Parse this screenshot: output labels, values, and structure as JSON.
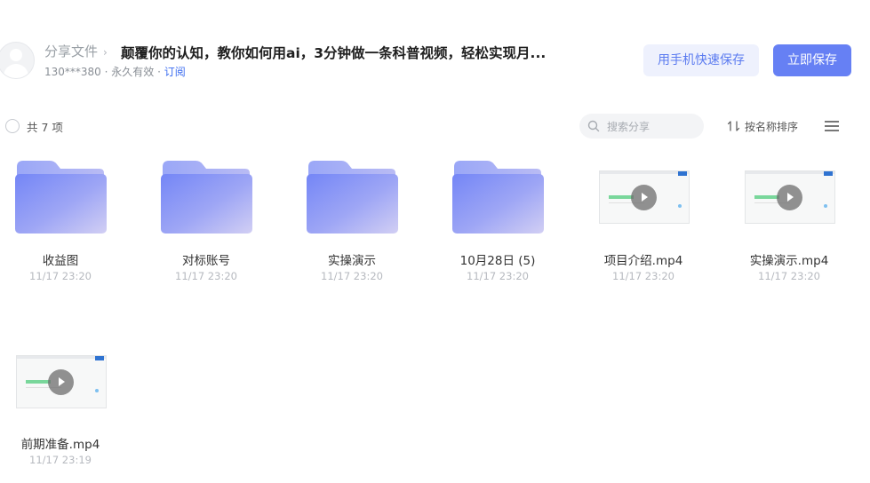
{
  "header": {
    "crumb": "分享文件",
    "title": "颠覆你的认知，教你如何用ai，3分钟做一条科普视频，轻松实现月...",
    "meta_prefix": "130***380 · 永久有效 · ",
    "subscribe": "订阅",
    "phone_save_label": "用手机快速保存",
    "save_label": "立即保存"
  },
  "toolbar": {
    "count": "共 7 项",
    "search_placeholder": "搜索分享",
    "sort_label": "按名称排序"
  },
  "files": [
    {
      "name": "收益图",
      "time": "11/17 23:20",
      "icon": "folder-icon"
    },
    {
      "name": "对标账号",
      "time": "11/17 23:20",
      "icon": "folder-icon"
    },
    {
      "name": "实操演示",
      "time": "11/17 23:20",
      "icon": "folder-icon"
    },
    {
      "name": "10月28日 (5)",
      "time": "11/17 23:20",
      "icon": "folder-icon"
    },
    {
      "name": "项目介绍.mp4",
      "time": "11/17 23:20",
      "icon": "video-thumbnail"
    },
    {
      "name": "实操演示.mp4",
      "time": "11/17 23:20",
      "icon": "video-thumbnail"
    },
    {
      "name": "前期准备.mp4",
      "time": "11/17 23:19",
      "icon": "video-thumbnail"
    }
  ],
  "colors": {
    "accent": "#6680f4",
    "accent_light": "#eef1fd",
    "link": "#3b6cf0",
    "folder_gradient_start": "#7d8ef7",
    "folder_gradient_end": "#c8c7f3"
  }
}
